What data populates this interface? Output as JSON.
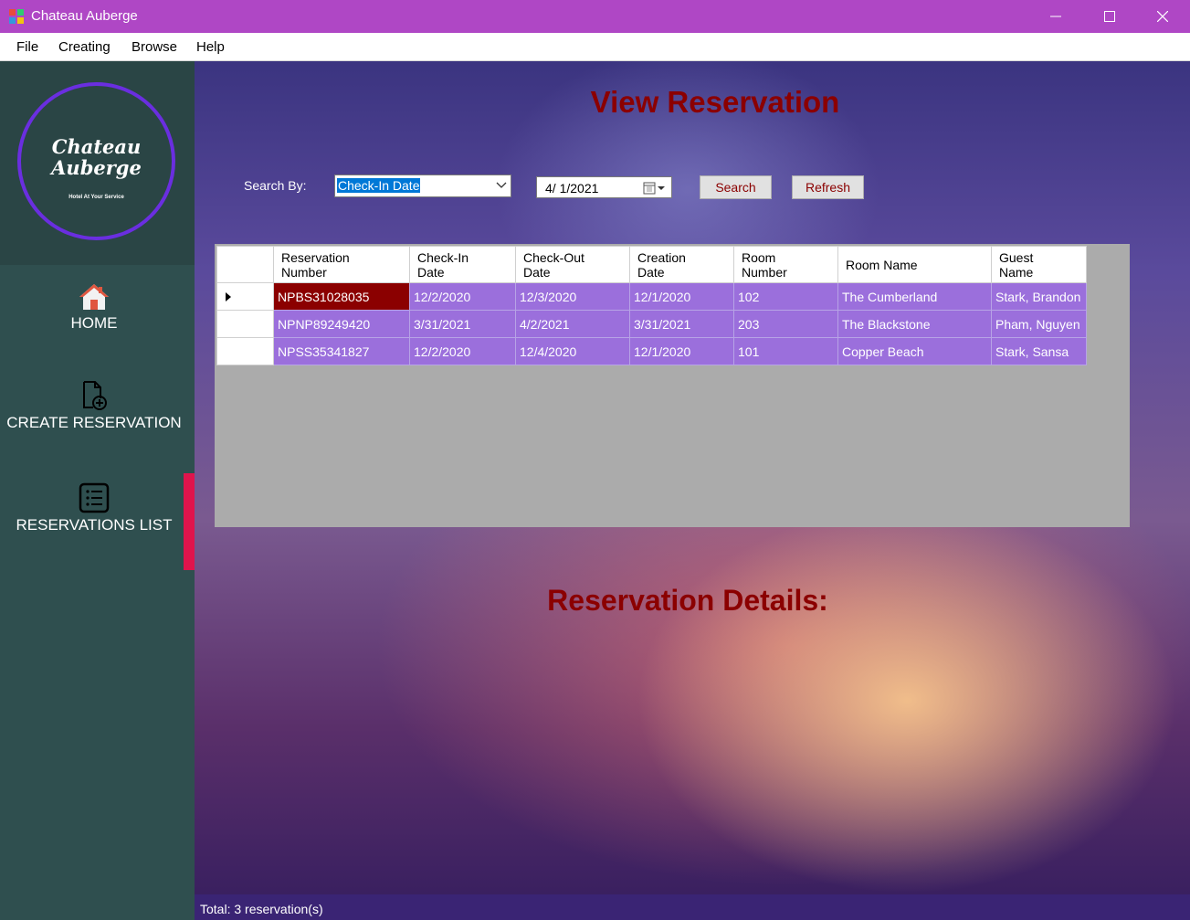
{
  "window": {
    "title": "Chateau Auberge"
  },
  "menu": {
    "items": [
      "File",
      "Creating",
      "Browse",
      "Help"
    ]
  },
  "sidebar": {
    "logo": {
      "line1": "Chateau",
      "line2": "Auberge",
      "tagline": "Hotel At Your Service"
    },
    "nav": [
      {
        "label": "HOME",
        "icon": "home-icon"
      },
      {
        "label": "CREATE RESERVATION",
        "icon": "file-plus-icon"
      },
      {
        "label": "RESERVATIONS LIST",
        "icon": "list-icon"
      }
    ],
    "active_index": 2
  },
  "main": {
    "title": "View Reservation",
    "search": {
      "label": "Search By:",
      "field_value": "Check-In Date",
      "date_value": "4/  1/2021",
      "search_label": "Search",
      "refresh_label": "Refresh"
    },
    "table": {
      "columns": [
        [
          "Reservation",
          "Number"
        ],
        [
          "Check-In",
          "Date"
        ],
        [
          "Check-Out",
          "Date"
        ],
        [
          "Creation",
          "Date"
        ],
        [
          "Room",
          "Number"
        ],
        [
          "Room Name",
          ""
        ],
        [
          "Guest",
          "Name"
        ]
      ],
      "rows": [
        [
          "NPBS31028035",
          "12/2/2020",
          "12/3/2020",
          "12/1/2020",
          "102",
          "The Cumberland",
          "Stark, Brandon"
        ],
        [
          "NPNP89249420",
          "3/31/2021",
          "4/2/2021",
          "3/31/2021",
          "203",
          "The Blackstone",
          "Pham, Nguyen"
        ],
        [
          "NPSS35341827",
          "12/2/2020",
          "12/4/2020",
          "12/1/2020",
          "101",
          "Copper Beach",
          "Stark, Sansa"
        ]
      ],
      "selected_row": 0
    },
    "details_title": "Reservation Details:"
  },
  "status": {
    "text": "Total: 3 reservation(s)"
  },
  "colors": {
    "titlebar": "#af47c5",
    "accent_red": "#8b0000",
    "row_purple": "#9b6fdc",
    "nav_active": "#e0144c"
  }
}
